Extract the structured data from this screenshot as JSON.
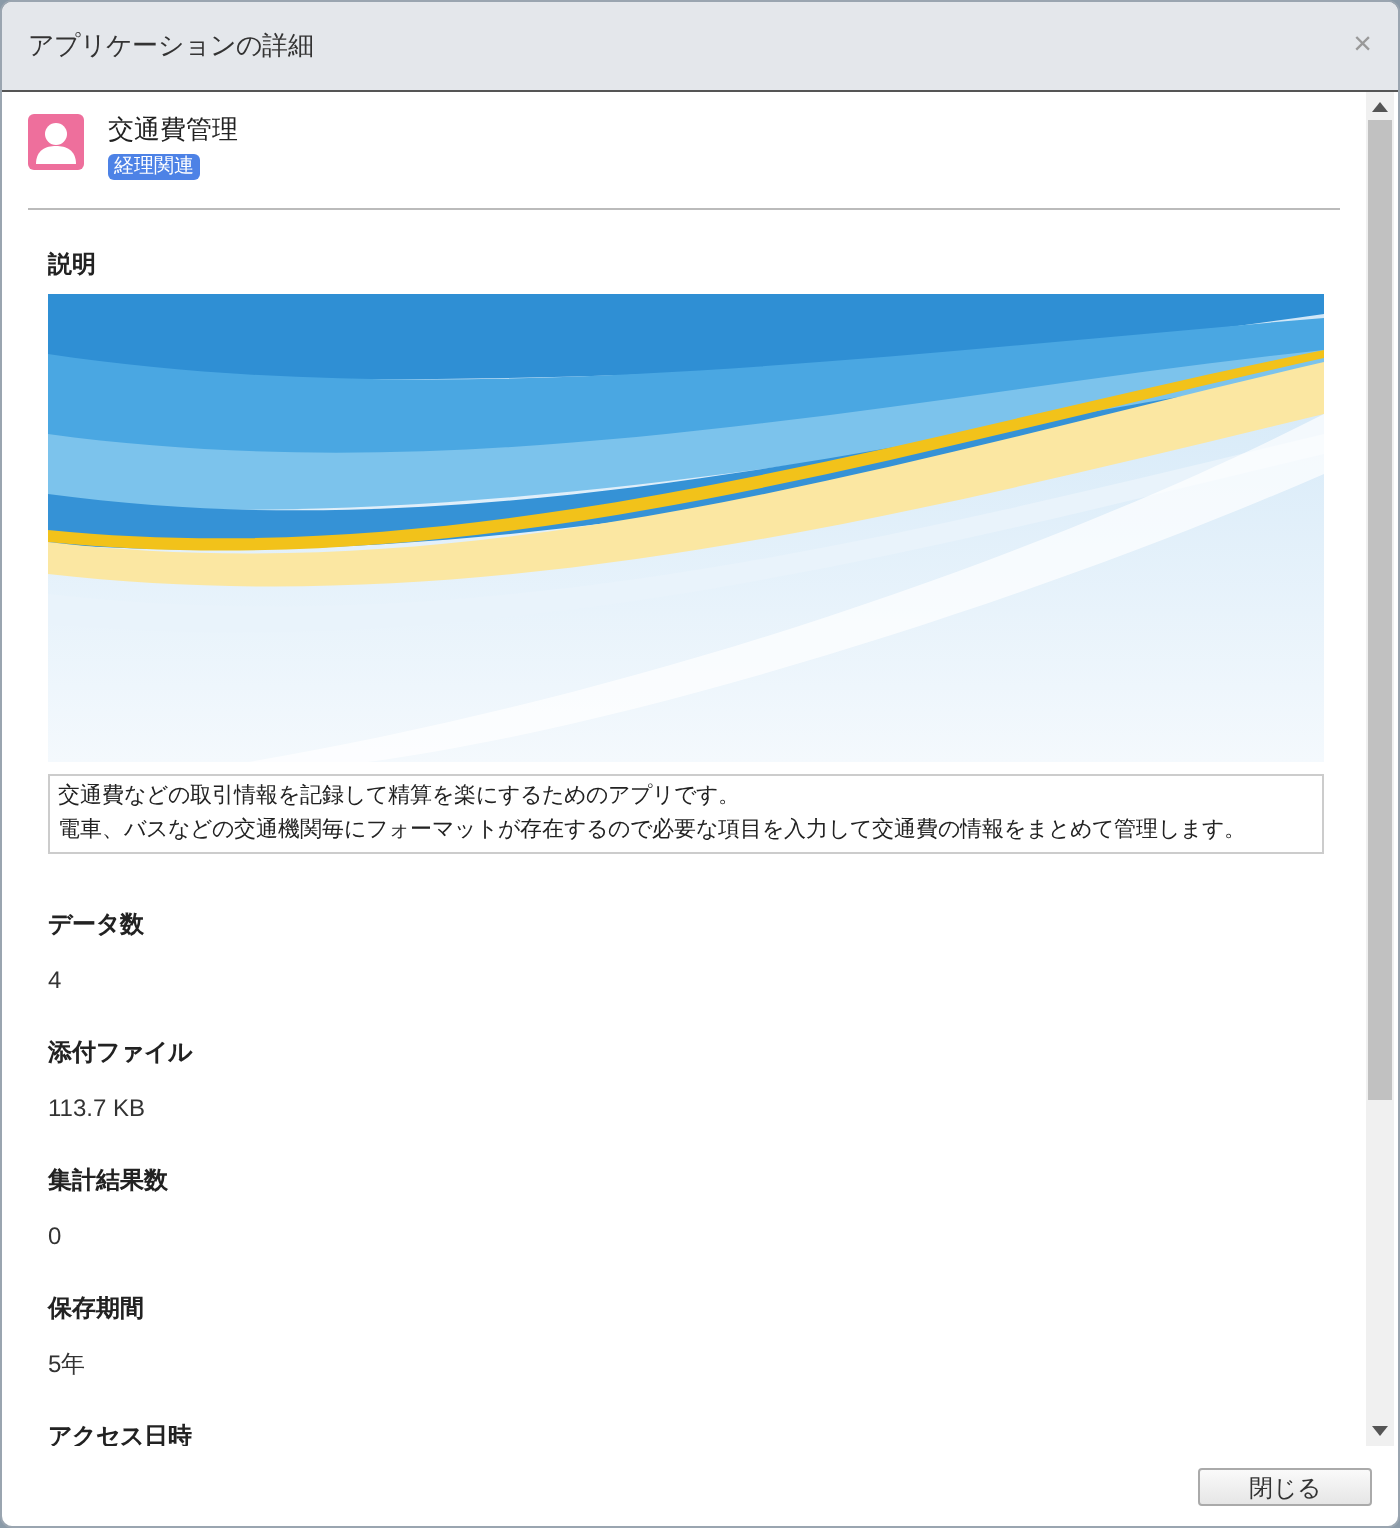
{
  "dialog": {
    "title": "アプリケーションの詳細",
    "close_icon": "×"
  },
  "app": {
    "name": "交通費管理",
    "tag": "経理関連"
  },
  "description": {
    "label": "説明",
    "text": [
      "交通費などの取引情報を記録して精算を楽にするためのアプリです。",
      "電車、バスなどの交通機関毎にフォーマットが存在するので必要な項目を入力して交通費の情報をまとめて管理します。"
    ]
  },
  "fields": [
    {
      "label": "データ数",
      "value": "4"
    },
    {
      "label": "添付ファイル",
      "value": "113.7 KB"
    },
    {
      "label": "集計結果数",
      "value": "0"
    },
    {
      "label": "保存期間",
      "value": "5年"
    },
    {
      "label": "アクセス日時"
    }
  ],
  "buttons": [
    "閉じる"
  ]
}
